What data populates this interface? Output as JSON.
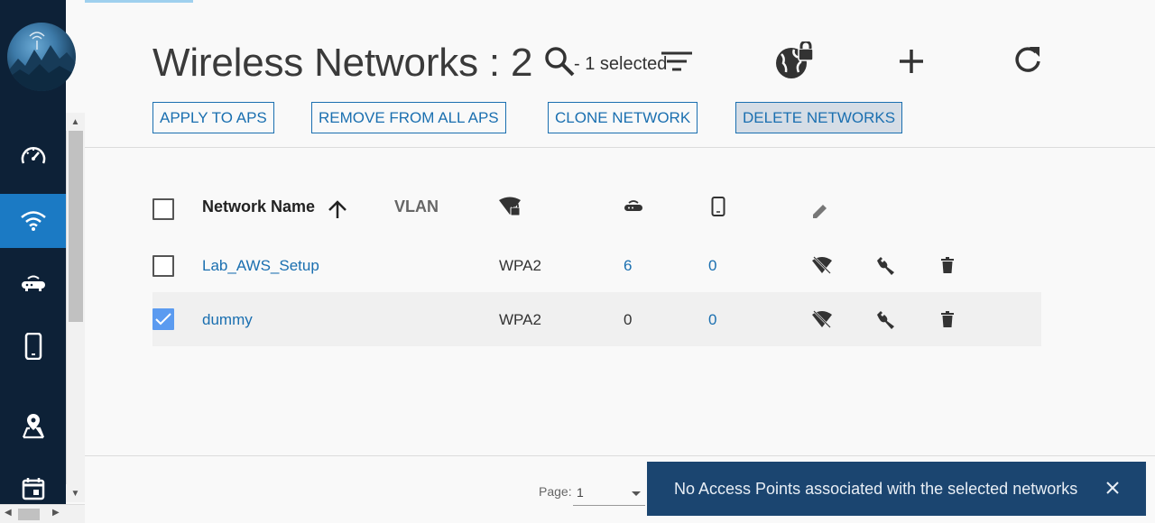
{
  "header": {
    "title": "Wireless Networks : 2",
    "selected_text": "- 1 selected"
  },
  "actions": {
    "apply": "APPLY TO APS",
    "remove": "REMOVE FROM ALL APS",
    "clone": "CLONE NETWORK",
    "delete": "DELETE NETWORKS"
  },
  "table": {
    "columns": {
      "network_name": "Network Name",
      "vlan": "VLAN"
    },
    "rows": [
      {
        "name": "Lab_AWS_Setup",
        "vlan": "",
        "security": "WPA2",
        "aps": "6",
        "clients": "0",
        "checked": false
      },
      {
        "name": "dummy",
        "vlan": "",
        "security": "WPA2",
        "aps": "0",
        "clients": "0",
        "checked": true
      }
    ]
  },
  "pagination": {
    "label": "Page:",
    "value": "1"
  },
  "toast": {
    "message": "No Access Points associated with the selected networks"
  },
  "icons": {
    "search": "search-icon",
    "filter": "filter-icon",
    "globe_lock": "globe-lock-icon",
    "add": "plus-icon",
    "refresh": "refresh-icon",
    "wifi_off": "wifi-off-icon",
    "wrench": "wrench-icon",
    "trash": "trash-icon"
  },
  "colors": {
    "sidebar": "#0d2137",
    "active_nav": "#1b7ac4",
    "link": "#1a6fb0",
    "toast": "#1b4570",
    "checkbox_checked": "#5b9bf0"
  }
}
